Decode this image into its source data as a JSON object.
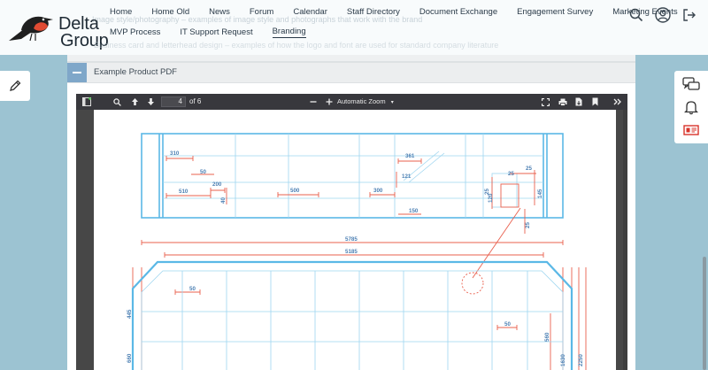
{
  "brand": {
    "line1": "Delta",
    "line2": "Group"
  },
  "nav": {
    "row1": [
      "Home",
      "Home Old",
      "News",
      "Forum",
      "Calendar",
      "Staff Directory",
      "Document Exchange",
      "Engagement Survey",
      "Marketing Events"
    ],
    "row2": [
      "MVP Process",
      "IT Support Request",
      "Branding"
    ],
    "active": "Branding"
  },
  "ghost": {
    "line1": "Image style/photography – examples of image style and photographs that work with the brand",
    "line2": "Business card and letterhead design – examples of how the logo and font are used for standard company literature"
  },
  "section": {
    "title": "Example Product PDF"
  },
  "pdf": {
    "page_current": "4",
    "page_total": "of 6",
    "zoom": "Automatic Zoom",
    "dims": {
      "d310": "310",
      "d50a": "50",
      "d510": "510",
      "d200": "200",
      "d40": "40",
      "d500": "500",
      "d300": "300",
      "d361": "361",
      "d121": "121",
      "d150": "150",
      "d25a": "25",
      "d25b": "25",
      "d120": "120",
      "d145": "145",
      "d25c": "25",
      "d25d": "25",
      "d5785": "5785",
      "d5185": "5185",
      "d50b": "50",
      "d445": "445",
      "d660": "660",
      "d50c": "50",
      "d560": "560",
      "d1630": "1630",
      "d2250": "2250"
    }
  },
  "colors": {
    "accent": "#7fa7c9",
    "blueprint_blue": "#5bb8e6",
    "blueprint_red": "#e9604e",
    "toolbar": "#38383d",
    "background": "#9cc3d2"
  },
  "icons": {
    "header": [
      "search-icon",
      "user-icon",
      "logout-icon"
    ],
    "left": "pencil-icon",
    "right": [
      "chat-icon",
      "bell-icon",
      "contact-card-icon"
    ]
  }
}
